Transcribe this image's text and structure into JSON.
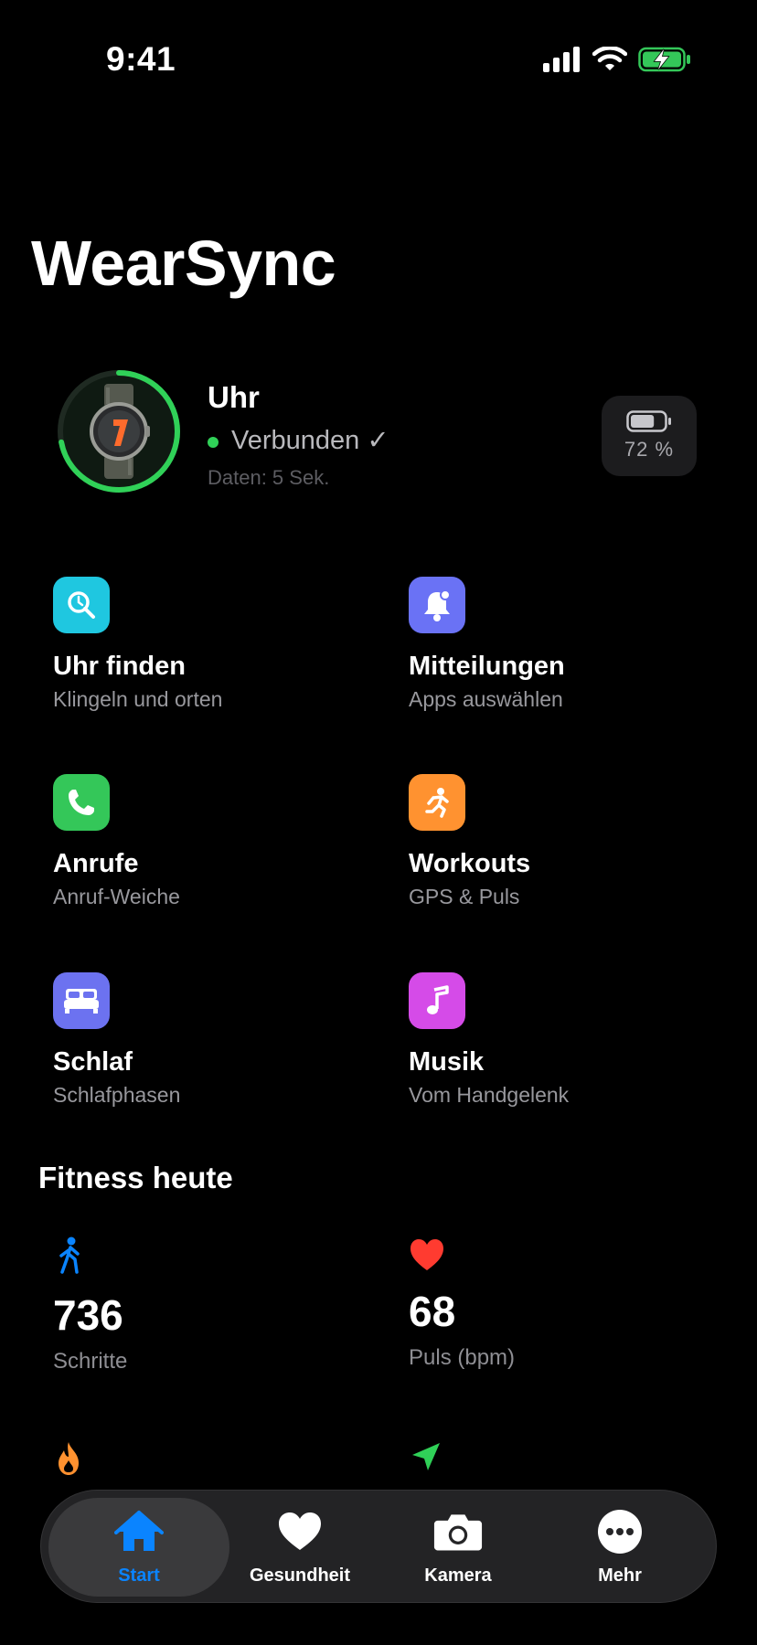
{
  "status_bar": {
    "time": "9:41"
  },
  "app": {
    "title": "WearSync"
  },
  "device": {
    "name": "Uhr",
    "status": "Verbunden ✓",
    "sync": "Daten: 5 Sek.",
    "battery_label": "72 %",
    "battery_level": 0.72,
    "ring_progress": 0.72
  },
  "features": [
    {
      "title": "Uhr finden",
      "subtitle": "Klingeln und orten",
      "icon": "find-watch-icon",
      "color": "#1fc7e0"
    },
    {
      "title": "Mitteilungen",
      "subtitle": "Apps auswählen",
      "icon": "bell-icon",
      "color": "#6a72f5"
    },
    {
      "title": "Anrufe",
      "subtitle": "Anruf-Weiche",
      "icon": "phone-icon",
      "color": "#34c759"
    },
    {
      "title": "Workouts",
      "subtitle": "GPS & Puls",
      "icon": "running-icon",
      "color": "#ff9230"
    },
    {
      "title": "Schlaf",
      "subtitle": "Schlafphasen",
      "icon": "bed-icon",
      "color": "#6c72f0"
    },
    {
      "title": "Musik",
      "subtitle": "Vom Handgelenk",
      "icon": "music-note-icon",
      "color": "#d54be8"
    }
  ],
  "fitness": {
    "title": "Fitness heute",
    "metrics": [
      {
        "value": "736",
        "label": "Schritte",
        "icon": "walking-icon",
        "color": "#0a84ff"
      },
      {
        "value": "68",
        "label": "Puls (bpm)",
        "icon": "heart-icon",
        "color": "#ff3b30"
      }
    ]
  },
  "tabs": [
    {
      "label": "Start",
      "icon": "house-icon",
      "active": true
    },
    {
      "label": "Gesundheit",
      "icon": "heart-icon",
      "active": false
    },
    {
      "label": "Kamera",
      "icon": "camera-icon",
      "active": false
    },
    {
      "label": "Mehr",
      "icon": "more-icon",
      "active": false
    }
  ]
}
